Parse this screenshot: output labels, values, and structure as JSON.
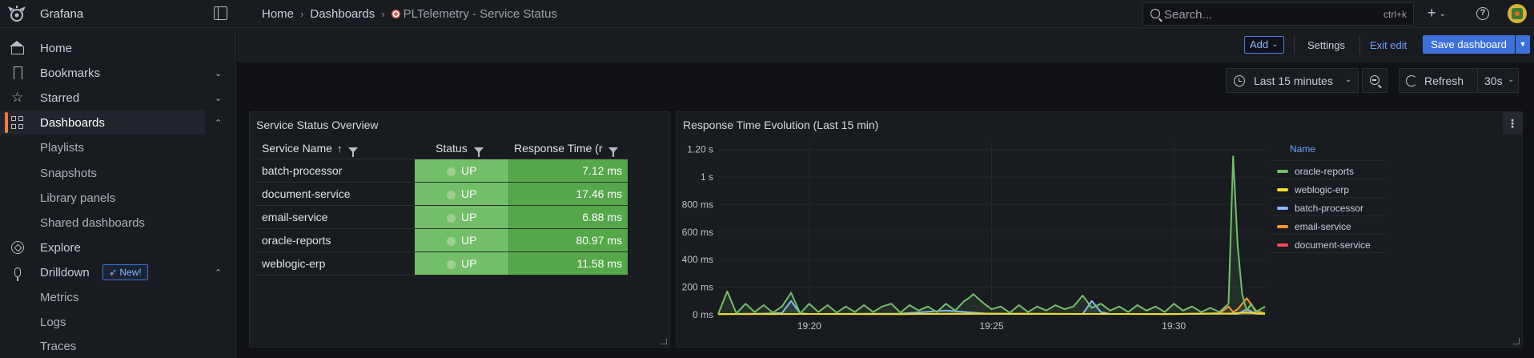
{
  "app": {
    "brand": "Grafana"
  },
  "breadcrumbs": [
    "Home",
    "Dashboards",
    "PLTelemetry - Service Status"
  ],
  "search": {
    "placeholder": "Search...",
    "shortcut": "ctrl+k"
  },
  "sidebar": {
    "items": [
      {
        "label": "Home",
        "icon": "home-icon"
      },
      {
        "label": "Bookmarks",
        "icon": "bookmark-icon",
        "expandable": true
      },
      {
        "label": "Starred",
        "icon": "star-icon",
        "expandable": true
      },
      {
        "label": "Dashboards",
        "icon": "grid-icon",
        "expandable": true,
        "active": true
      },
      {
        "label": "Playlists",
        "sub": true
      },
      {
        "label": "Snapshots",
        "sub": true
      },
      {
        "label": "Library panels",
        "sub": true
      },
      {
        "label": "Shared dashboards",
        "sub": true
      },
      {
        "label": "Explore",
        "icon": "compass-icon"
      },
      {
        "label": "Drilldown",
        "icon": "drilldown-icon",
        "badge": "New!",
        "expandable": true
      },
      {
        "label": "Metrics",
        "sub": true
      },
      {
        "label": "Logs",
        "sub": true
      },
      {
        "label": "Traces",
        "sub": true
      }
    ]
  },
  "toolbar": {
    "add_label": "Add",
    "settings_label": "Settings",
    "exit_label": "Exit edit",
    "save_label": "Save dashboard"
  },
  "timebar": {
    "range_label": "Last 15 minutes",
    "refresh_label": "Refresh",
    "interval_label": "30s"
  },
  "table_panel": {
    "title": "Service Status Overview",
    "columns": [
      "Service Name",
      "Status",
      "Response Time (r"
    ],
    "rows": [
      {
        "name": "batch-processor",
        "status": "UP",
        "rt": "7.12 ms"
      },
      {
        "name": "document-service",
        "status": "UP",
        "rt": "17.46 ms"
      },
      {
        "name": "email-service",
        "status": "UP",
        "rt": "6.88 ms"
      },
      {
        "name": "oracle-reports",
        "status": "UP",
        "rt": "80.97 ms"
      },
      {
        "name": "weblogic-erp",
        "status": "UP",
        "rt": "11.58 ms"
      }
    ]
  },
  "chart_panel": {
    "title": "Response Time Evolution (Last 15 min)",
    "legend_header": "Name"
  },
  "chart_data": {
    "type": "line",
    "title": "Response Time Evolution (Last 15 min)",
    "xlabel": "",
    "ylabel": "",
    "x_tick_labels": [
      "19:20",
      "19:25",
      "19:30"
    ],
    "y_tick_labels": [
      "0 ms",
      "200 ms",
      "400 ms",
      "600 ms",
      "800 ms",
      "1 s",
      "1.20 s"
    ],
    "y_unit": "ms",
    "ylim": [
      0,
      1250
    ],
    "xlim": [
      0,
      60
    ],
    "x_ticks": [
      10,
      30,
      50
    ],
    "y_ticks": [
      0,
      200,
      400,
      600,
      800,
      1000,
      1200
    ],
    "grid": true,
    "legend_position": "right",
    "series": [
      {
        "name": "oracle-reports",
        "color": "#73bf69",
        "x": [
          0,
          1,
          2,
          3,
          4,
          5,
          6,
          7,
          8,
          9,
          10,
          11,
          12,
          13,
          14,
          15,
          16,
          17,
          18,
          19,
          20,
          21,
          22,
          23,
          24,
          25,
          26,
          27,
          27.5,
          28,
          29,
          30,
          31,
          32,
          33,
          34,
          35,
          36,
          37,
          38,
          39,
          40,
          41,
          42,
          43,
          44,
          45,
          46,
          47,
          48,
          49,
          50,
          51,
          52,
          53,
          54,
          55,
          56,
          56.5,
          57,
          57.5,
          58,
          58.5,
          59,
          60
        ],
        "values": [
          5,
          170,
          10,
          80,
          20,
          70,
          15,
          60,
          160,
          10,
          80,
          20,
          70,
          15,
          60,
          20,
          70,
          20,
          60,
          80,
          15,
          70,
          30,
          60,
          20,
          80,
          30,
          100,
          120,
          150,
          90,
          40,
          60,
          15,
          70,
          20,
          60,
          30,
          70,
          40,
          60,
          140,
          50,
          80,
          30,
          60,
          20,
          70,
          30,
          60,
          20,
          80,
          30,
          60,
          20,
          50,
          20,
          80,
          1150,
          500,
          150,
          30,
          80,
          20,
          60
        ]
      },
      {
        "name": "weblogic-erp",
        "color": "#fade2a",
        "x": [
          0,
          10,
          20,
          30,
          40,
          50,
          55,
          56,
          57,
          58,
          59,
          60
        ],
        "values": [
          5,
          6,
          5,
          8,
          6,
          5,
          10,
          8,
          12,
          15,
          10,
          8
        ]
      },
      {
        "name": "batch-processor",
        "color": "#8ab8ff",
        "x": [
          0,
          5,
          7,
          8,
          9,
          10,
          20,
          25,
          30,
          40,
          41,
          42,
          43,
          50,
          56,
          57,
          58,
          59,
          60
        ],
        "values": [
          5,
          8,
          12,
          100,
          10,
          6,
          8,
          30,
          6,
          6,
          100,
          20,
          6,
          6,
          8,
          6,
          40,
          8,
          6
        ]
      },
      {
        "name": "email-service",
        "color": "#ff9830",
        "x": [
          0,
          10,
          20,
          30,
          40,
          50,
          55,
          56,
          56.5,
          57,
          58,
          59,
          60
        ],
        "values": [
          5,
          6,
          5,
          8,
          6,
          5,
          10,
          60,
          20,
          40,
          120,
          30,
          10
        ]
      },
      {
        "name": "document-service",
        "color": "#f2495c",
        "x": [
          0,
          10,
          20,
          30,
          40,
          50,
          55,
          57,
          58,
          59,
          60
        ],
        "values": [
          5,
          6,
          5,
          7,
          6,
          5,
          8,
          10,
          20,
          15,
          10
        ]
      }
    ]
  }
}
